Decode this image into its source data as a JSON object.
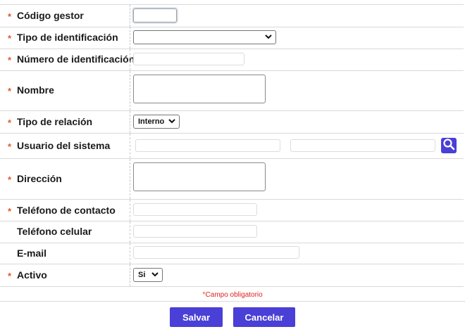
{
  "form": {
    "fields": {
      "codigo_gestor": {
        "label": "Código gestor",
        "required": true,
        "value": ""
      },
      "tipo_identificacion": {
        "label": "Tipo de identificación",
        "required": true,
        "value": ""
      },
      "numero_identificacion": {
        "label": "Número de identificación",
        "required": true,
        "value": ""
      },
      "nombre": {
        "label": "Nombre",
        "required": true,
        "value": ""
      },
      "tipo_relacion": {
        "label": "Tipo de relación",
        "required": true,
        "value": "Interno"
      },
      "usuario_sistema": {
        "label": "Usuario del sistema",
        "required": true,
        "value_code": "",
        "value_name": ""
      },
      "direccion": {
        "label": "Dirección",
        "required": true,
        "value": ""
      },
      "telefono_contacto": {
        "label": "Teléfono de contacto",
        "required": true,
        "value": ""
      },
      "telefono_celular": {
        "label": "Teléfono celular",
        "required": false,
        "value": ""
      },
      "email": {
        "label": "E-mail",
        "required": false,
        "value": ""
      },
      "activo": {
        "label": "Activo",
        "required": true,
        "value": "Si"
      }
    },
    "required_marker": "*",
    "required_note": "Campo obligatorio"
  },
  "actions": {
    "save_label": "Salvar",
    "cancel_label": "Cancelar"
  },
  "icons": {
    "search": "search-icon",
    "dropdown": "chevron-down-icon"
  },
  "colors": {
    "accent": "#4a3fd6",
    "required": "#e4572e",
    "note": "#e02020"
  }
}
